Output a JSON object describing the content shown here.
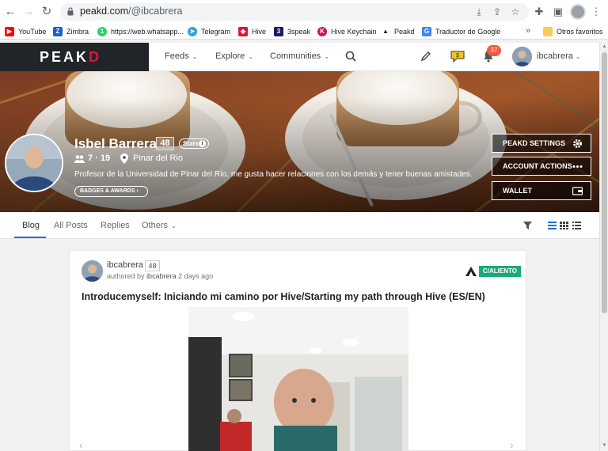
{
  "browser": {
    "url_host": "peakd.com",
    "url_path": "/@ibcabrera",
    "bookmarks": [
      {
        "label": "YouTube",
        "color": "#ff0000"
      },
      {
        "label": "Zimbra",
        "color": "#1565c0"
      },
      {
        "label": "https://web.whatsapp...",
        "color": "#25d366"
      },
      {
        "label": "Telegram",
        "color": "#2aa3df"
      },
      {
        "label": "Hive",
        "color": "#e31337"
      },
      {
        "label": "3speak",
        "color": "#1a1a60"
      },
      {
        "label": "Hive Keychain",
        "color": "#c2185b"
      },
      {
        "label": "Peakd",
        "color": "#212529"
      },
      {
        "label": "Traductor de Google",
        "color": "#4285f4"
      }
    ],
    "more_bookmarks": "»",
    "other_bookmarks": "Otros favoritos"
  },
  "site": {
    "logo_main": "PEAK",
    "logo_accent": "D",
    "nav": [
      "Feeds",
      "Explore",
      "Communities"
    ],
    "notifications": "37",
    "username": "ibcabrera"
  },
  "profile": {
    "display_name": "Isbel Barrera",
    "reputation": "48",
    "stats_label": "Stats",
    "following": "7",
    "followers": "19",
    "follow_sep": "·",
    "location": "Pinar del Rio",
    "bio": "Profesor de la Universidad de Pinar del Río, me gusta hacer relaciones con los demás y tener buenas amistades.",
    "badges_label": "BADGES & AWARDS",
    "actions": [
      "PEAKD SETTINGS",
      "ACCOUNT ACTIONS",
      "WALLET"
    ]
  },
  "tabs": {
    "items": [
      "Blog",
      "All Posts",
      "Replies",
      "Others"
    ],
    "active": "Blog"
  },
  "post": {
    "author": "ibcabrera",
    "reputation": "48",
    "authored_by_prefix": "authored by",
    "authored_by": "ibcabrera",
    "age": "2 days ago",
    "community": "C/ALIENTO",
    "title": "Introducemyself: Iniciando mi camino por Hive/Starting my path through Hive (ES/EN)"
  },
  "colors": {
    "accent_blue": "#1f6fce",
    "hive_red": "#e31337",
    "community_green": "#1aa97b",
    "notif_orange": "#f05b3f"
  }
}
